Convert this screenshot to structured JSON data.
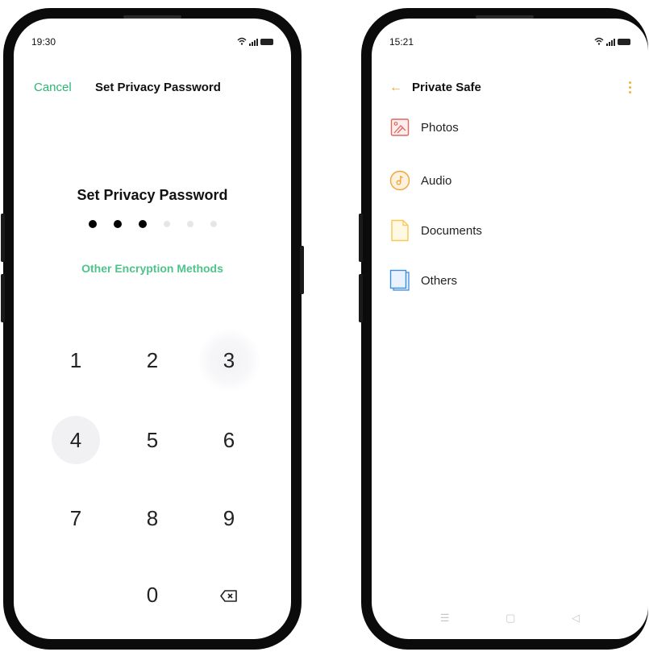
{
  "left_phone": {
    "status": {
      "time": "19:30"
    },
    "header": {
      "cancel": "Cancel",
      "title": "Set Privacy Password"
    },
    "pin": {
      "heading": "Set Privacy Password",
      "entered": 3,
      "length": 6
    },
    "other_methods": "Other Encryption Methods",
    "keypad": {
      "k1": "1",
      "k2": "2",
      "k3": "3",
      "k4": "4",
      "k5": "5",
      "k6": "6",
      "k7": "7",
      "k8": "8",
      "k9": "9",
      "k0": "0",
      "backspace_icon": "backspace-icon"
    }
  },
  "right_phone": {
    "status": {
      "time": "15:21"
    },
    "header": {
      "title": "Private Safe"
    },
    "folders": [
      {
        "label": "Photos",
        "icon": "photos-icon",
        "color": "#e2675f"
      },
      {
        "label": "Audio",
        "icon": "audio-icon",
        "color": "#f0a533"
      },
      {
        "label": "Documents",
        "icon": "documents-icon",
        "color": "#f6c957"
      },
      {
        "label": "Others",
        "icon": "others-icon",
        "color": "#3c8fe0"
      }
    ],
    "navbar": {
      "menu": "☰",
      "home": "▢",
      "back": "◁"
    }
  },
  "colors": {
    "accent_green": "#2bb673",
    "accent_orange": "#f0a533"
  }
}
